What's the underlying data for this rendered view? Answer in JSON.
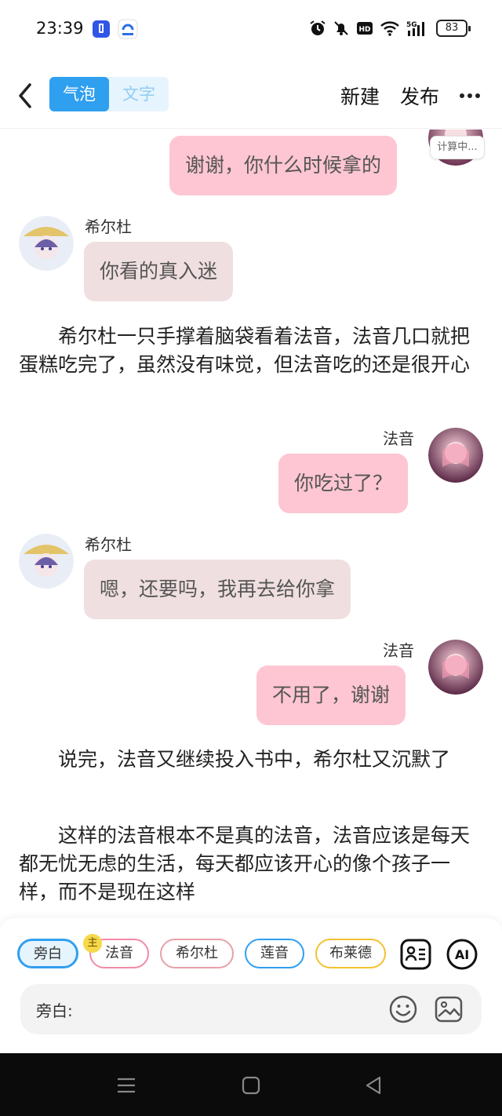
{
  "status_bar": {
    "time": "23:39",
    "indicators": [
      "alarm-icon",
      "mute-icon",
      "hd-icon",
      "wifi-icon",
      "5g-signal-icon"
    ],
    "battery": "83"
  },
  "header": {
    "tabs": [
      {
        "label": "气泡",
        "active": true
      },
      {
        "label": "文字",
        "active": false
      }
    ],
    "new_label": "新建",
    "publish_label": "发布"
  },
  "chat": {
    "calc_badge": "计算中...",
    "messages": [
      {
        "type": "bubble",
        "side": "right",
        "speaker": "",
        "text": "谢谢，你什么时候拿的"
      },
      {
        "type": "bubble",
        "side": "left",
        "speaker": "希尔杜",
        "text": "你看的真入迷"
      },
      {
        "type": "narration",
        "text": "希尔杜一只手撑着脑袋看着法音，法音几口就把蛋糕吃完了，虽然没有味觉，但法音吃的还是很开心"
      },
      {
        "type": "bubble",
        "side": "right",
        "speaker": "法音",
        "text": "你吃过了？"
      },
      {
        "type": "bubble",
        "side": "left",
        "speaker": "希尔杜",
        "text": "嗯，还要吗，我再去给你拿"
      },
      {
        "type": "bubble",
        "side": "right",
        "speaker": "法音",
        "text": "不用了，谢谢"
      },
      {
        "type": "narration",
        "text": "说完，法音又继续投入书中，希尔杜又沉默了"
      },
      {
        "type": "narration",
        "text": "这样的法音根本不是真的法音，法音应该是每天都无忧无虑的生活，每天都应该开心的像个孩子一样，而不是现在这样"
      }
    ]
  },
  "composer": {
    "roles": [
      {
        "label": "旁白",
        "color": "#2f9ff0",
        "selected": true
      },
      {
        "label": "法音",
        "color": "#f28aa7",
        "host": true
      },
      {
        "label": "希尔杜",
        "color": "#e8a0a8"
      },
      {
        "label": "莲音",
        "color": "#2f9ff0"
      },
      {
        "label": "布莱德",
        "color": "#f2c232"
      }
    ],
    "host_badge": "主",
    "ai_label": "AI",
    "input_label": "旁白:",
    "input_value": "",
    "input_placeholder": ""
  },
  "colors": {
    "accent": "#2f9ff0",
    "bubble_right": "#fdc6d2",
    "bubble_left": "#f0dfe0"
  }
}
